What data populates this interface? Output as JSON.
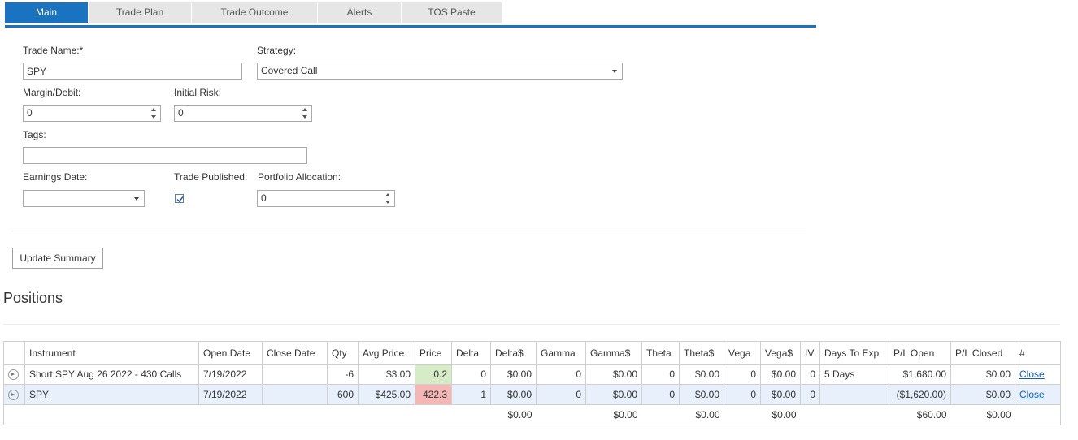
{
  "tabs": [
    {
      "label": "Main",
      "active": true
    },
    {
      "label": "Trade Plan"
    },
    {
      "label": "Trade Outcome"
    },
    {
      "label": "Alerts"
    },
    {
      "label": "TOS Paste"
    }
  ],
  "form": {
    "trade_name_label": "Trade Name:*",
    "trade_name_value": "SPY",
    "strategy_label": "Strategy:",
    "strategy_value": "Covered Call",
    "margin_label": "Margin/Debit:",
    "margin_value": "0",
    "initial_risk_label": "Initial Risk:",
    "initial_risk_value": "0",
    "tags_label": "Tags:",
    "tags_value": "",
    "earnings_label": "Earnings Date:",
    "earnings_value": "",
    "published_label": "Trade Published:",
    "published_checked": true,
    "allocation_label": "Portfolio Allocation:",
    "allocation_value": "0"
  },
  "update_button_label": "Update Summary",
  "positions": {
    "title": "Positions",
    "headers": [
      "",
      "Instrument",
      "Open Date",
      "Close Date",
      "Qty",
      "Avg Price",
      "Price",
      "Delta",
      "Delta$",
      "Gamma",
      "Gamma$",
      "Theta",
      "Theta$",
      "Vega",
      "Vega$",
      "IV",
      "Days To Exp",
      "P/L Open",
      "P/L Closed",
      "#"
    ],
    "rows": [
      {
        "instrument": "Short SPY Aug 26 2022 - 430 Calls",
        "open_date": "7/19/2022",
        "close_date": "",
        "qty": "-6",
        "avg_price": "$3.00",
        "price": "0.2",
        "delta": "0",
        "delta_d": "$0.00",
        "gamma": "0",
        "gamma_d": "$0.00",
        "theta": "0",
        "theta_d": "$0.00",
        "vega": "0",
        "vega_d": "$0.00",
        "iv": "0",
        "days_to_exp": "5 Days",
        "pl_open": "$1,680.00",
        "pl_closed": "$0.00",
        "action": "Close"
      },
      {
        "instrument": "SPY",
        "open_date": "7/19/2022",
        "close_date": "",
        "qty": "600",
        "avg_price": "$425.00",
        "price": "422.3",
        "delta": "1",
        "delta_d": "$0.00",
        "gamma": "0",
        "gamma_d": "$0.00",
        "theta": "0",
        "theta_d": "$0.00",
        "vega": "0",
        "vega_d": "$0.00",
        "iv": "0",
        "days_to_exp": "",
        "pl_open": "($1,620.00)",
        "pl_closed": "$0.00",
        "action": "Close"
      }
    ],
    "totals": {
      "delta_d": "$0.00",
      "gamma_d": "$0.00",
      "theta_d": "$0.00",
      "vega_d": "$0.00",
      "pl_open": "$60.00",
      "pl_closed": "$0.00"
    }
  },
  "colors": {
    "accent": "#1a73c1",
    "price_up": "#d6ecc7",
    "price_down": "#f4b7b5",
    "selected_row": "#e7f0fb"
  }
}
